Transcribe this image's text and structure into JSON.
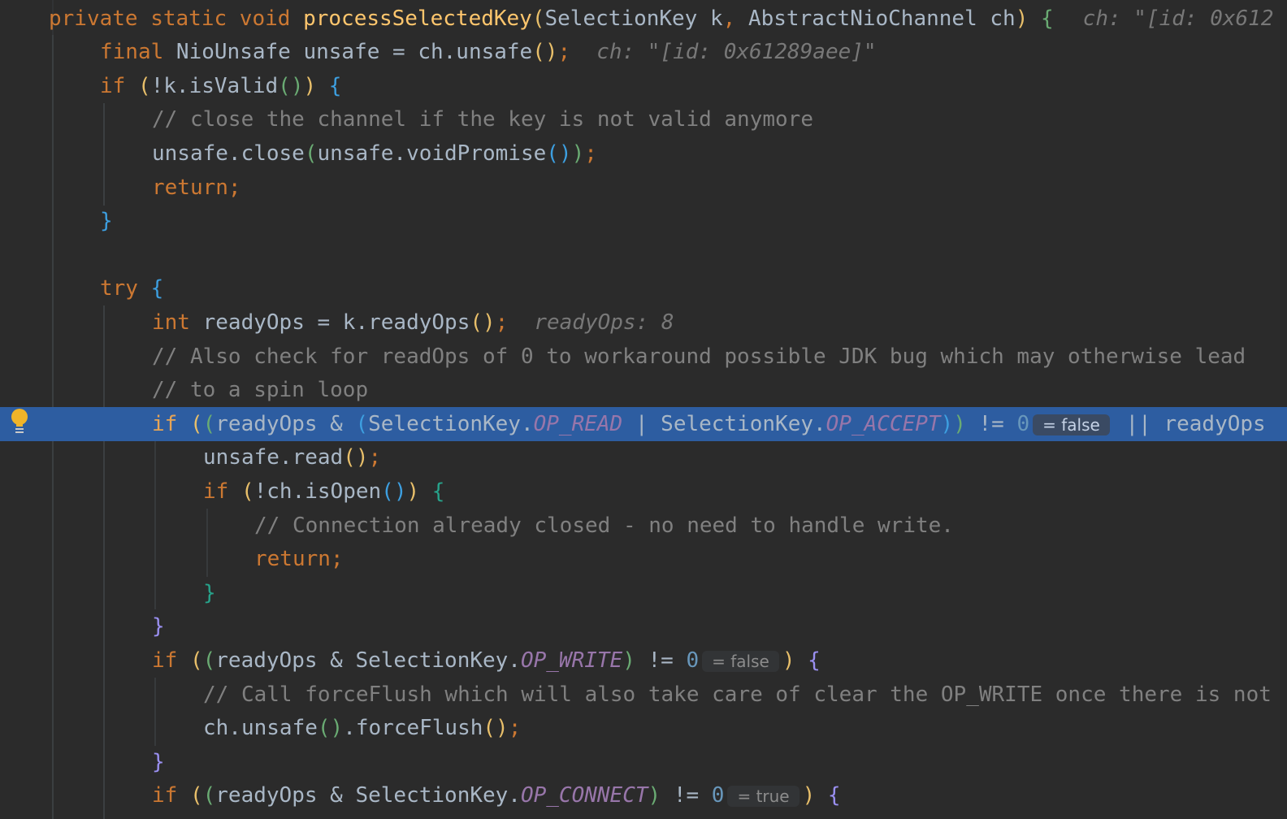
{
  "editor": {
    "lines": {
      "l0": {
        "kw1": "private static void ",
        "fn": "processSelectedKey",
        "open": "(",
        "params": "SelectionKey k",
        "comma": ", ",
        "params2": "AbstractNioChannel ch",
        "close": ")",
        "brace": " {",
        "hint": "ch: \"[id: 0x612"
      },
      "l1": {
        "kw": "final ",
        "a": "NioUnsafe unsafe = ch.unsafe",
        "paren": "()",
        "semi": ";",
        "hint": "ch: \"[id: 0x61289aee]\""
      },
      "l2": {
        "kw": "if ",
        "p1o": "(",
        "a": "!k.isValid",
        "p2": "()",
        "p1c": ")",
        "brace": " {"
      },
      "l3": {
        "comment": "// close the channel if the key is not valid anymore"
      },
      "l4": {
        "a": "unsafe.close",
        "po": "(",
        "b": "unsafe.voidPromise",
        "pi": "()",
        "pc": ")",
        "semi": ";"
      },
      "l5": {
        "kw": "return;"
      },
      "l6": {
        "brace": "}"
      },
      "l8": {
        "kw": "try ",
        "brace": "{"
      },
      "l9": {
        "kw": "int ",
        "a": "readyOps = k.readyOps",
        "paren": "()",
        "semi": ";",
        "hint": "readyOps: 8"
      },
      "l10": {
        "comment": "// Also check for readOps of 0 to workaround possible JDK bug which may otherwise lead"
      },
      "l11": {
        "comment": "// to a spin loop"
      },
      "l12": {
        "kw": "if ",
        "p1o": "(",
        "p2o": "(",
        "a": "readyOps & ",
        "p3o": "(",
        "b": "SelectionKey.",
        "c1": "OP_READ",
        "d": " | SelectionKey.",
        "c2": "OP_ACCEPT",
        "p3c": ")",
        "p2c": ")",
        "e": " != ",
        "num": "0",
        "inlay": "= false",
        "f": " || readyOps"
      },
      "l13": {
        "a": "unsafe.read",
        "paren": "()",
        "semi": ";"
      },
      "l14": {
        "kw": "if ",
        "p1o": "(",
        "a": "!ch.isOpen",
        "p2": "()",
        "p1c": ")",
        "brace": " {"
      },
      "l15": {
        "comment": "// Connection already closed - no need to handle write."
      },
      "l16": {
        "kw": "return;"
      },
      "l17": {
        "brace": "}"
      },
      "l18": {
        "brace": "}"
      },
      "l19": {
        "kw": "if ",
        "p1o": "(",
        "p2o": "(",
        "a": "readyOps & SelectionKey.",
        "c": "OP_WRITE",
        "p2c": ")",
        "e": " != ",
        "num": "0",
        "inlay": "= false",
        "p1c": ")",
        "brace": " {"
      },
      "l20": {
        "comment": "// Call forceFlush which will also take care of clear the OP_WRITE once there is not"
      },
      "l21": {
        "a": "ch.unsafe",
        "p1": "()",
        "b": ".forceFlush",
        "p2": "()",
        "semi": ";"
      },
      "l22": {
        "brace": "}"
      },
      "l23": {
        "kw": "if ",
        "p1o": "(",
        "p2o": "(",
        "a": "readyOps & SelectionKey.",
        "c": "OP_CONNECT",
        "p2c": ")",
        "e": " != ",
        "num": "0",
        "inlay": "= true",
        "p1c": ")",
        "brace": " {"
      }
    }
  },
  "colors": {
    "background": "#2b2b2b",
    "current_line": "#2d5da1",
    "keyword": "#cc7832",
    "function": "#ffc66d",
    "comment": "#808080",
    "constant": "#9876aa",
    "number": "#6897bb"
  },
  "gutter": {
    "icon": "lightbulb-icon"
  }
}
